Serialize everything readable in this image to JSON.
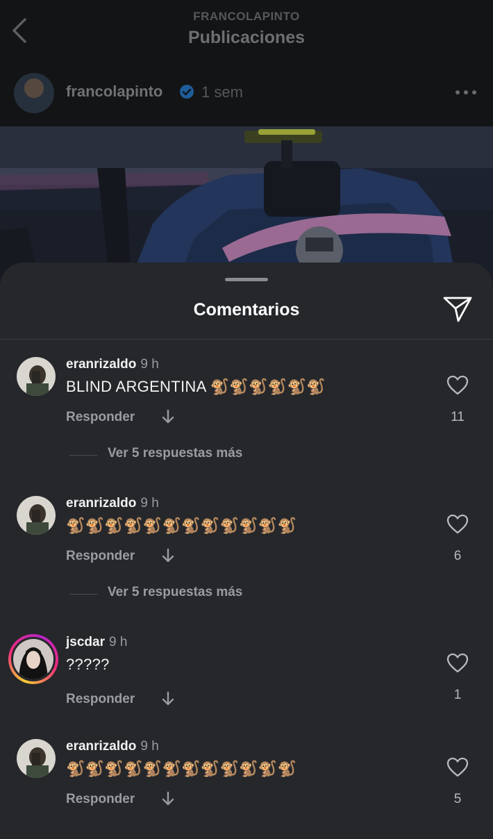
{
  "header": {
    "account": "FRANCOLAPINTO",
    "title": "Publicaciones"
  },
  "post": {
    "username": "francolapinto",
    "time": "1 sem"
  },
  "comments_sheet": {
    "title": "Comentarios",
    "comments": [
      {
        "username": "eranrizaldo",
        "time": "9 h",
        "text": "BLIND ARGENTINA 🐒🐒🐒🐒🐒🐒",
        "reply_label": "Responder",
        "likes": "11",
        "view_replies": "Ver 5 respuestas más"
      },
      {
        "username": "eranrizaldo",
        "time": "9 h",
        "text": "🐒🐒🐒🐒🐒🐒🐒🐒🐒🐒🐒🐒",
        "reply_label": "Responder",
        "likes": "6",
        "view_replies": "Ver 5 respuestas más"
      },
      {
        "username": "jscdar",
        "time": "9 h",
        "text": "?????",
        "reply_label": "Responder",
        "likes": "1"
      },
      {
        "username": "eranrizaldo",
        "time": "9 h",
        "text": "🐒🐒🐒🐒🐒🐒🐒🐒🐒🐒🐒🐒",
        "reply_label": "Responder",
        "likes": "5"
      }
    ]
  },
  "colors": {
    "sheet_bg": "#25272b",
    "verified_blue": "#3897f0",
    "story_ring": "#ee2a7b"
  },
  "icons": [
    "back-arrow-icon",
    "verified-badge-icon",
    "more-options-icon",
    "share-send-icon",
    "heart-icon",
    "down-arrow-icon"
  ]
}
